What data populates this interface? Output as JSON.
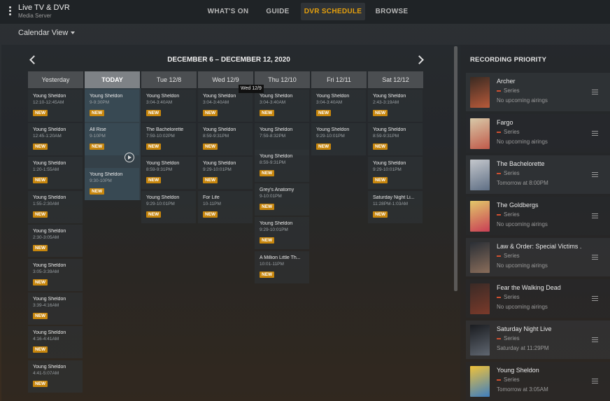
{
  "app": {
    "title": "Live TV & DVR",
    "subtitle": "Media Server"
  },
  "nav": {
    "tabs": [
      "WHAT'S ON",
      "GUIDE",
      "DVR SCHEDULE",
      "BROWSE"
    ],
    "active": "DVR SCHEDULE"
  },
  "view_selector": "Calendar View",
  "calendar": {
    "date_range": "DECEMBER 6 – DECEMBER 12, 2020",
    "days": [
      "Yesterday",
      "TODAY",
      "Tue 12/8",
      "Wed 12/9",
      "Thu 12/10",
      "Fri 12/11",
      "Sat 12/12"
    ],
    "tooltip": "Wed 12/9",
    "badge_label": "NEW",
    "events": [
      [
        {
          "title": "Young Sheldon",
          "time": "12:10-12:45AM",
          "badge": "NEW"
        },
        {
          "title": "Young Sheldon",
          "time": "12:45-1:20AM",
          "badge": "NEW"
        },
        {
          "title": "Young Sheldon",
          "time": "1:20-1:55AM",
          "badge": "NEW"
        },
        {
          "title": "Young Sheldon",
          "time": "1:55-2:30AM",
          "badge": "NEW"
        },
        {
          "title": "Young Sheldon",
          "time": "2:30-3:05AM",
          "badge": "NEW"
        },
        {
          "title": "Young Sheldon",
          "time": "3:05-3:39AM",
          "badge": "NEW"
        },
        {
          "title": "Young Sheldon",
          "time": "3:39-4:16AM",
          "badge": "NEW"
        },
        {
          "title": "Young Sheldon",
          "time": "4:16-4:41AM",
          "badge": "NEW"
        },
        {
          "title": "Young Sheldon",
          "time": "4:41-5:07AM",
          "badge": "NEW"
        }
      ],
      [
        {
          "title": "Young Sheldon",
          "time": "9-9:30PM",
          "badge": "NEW"
        },
        {
          "title": "All Rise",
          "time": "9-10PM",
          "badge": "NEW"
        },
        {
          "title": "Young Sheldon",
          "time": "9:30-10PM",
          "badge": "NEW"
        }
      ],
      [
        {
          "title": "Young Sheldon",
          "time": "3:04-3:40AM",
          "badge": "NEW"
        },
        {
          "title": "The Bachelorette",
          "time": "7:59-10:02PM",
          "badge": "NEW"
        },
        {
          "title": "Young Sheldon",
          "time": "8:59-9:31PM",
          "badge": "NEW"
        },
        {
          "title": "Young Sheldon",
          "time": "9:29-10:01PM",
          "badge": "NEW"
        }
      ],
      [
        {
          "title": "Young Sheldon",
          "time": "3:04-3:40AM",
          "badge": "NEW"
        },
        {
          "title": "Young Sheldon",
          "time": "8:59-9:31PM",
          "badge": "NEW"
        },
        {
          "title": "Young Sheldon",
          "time": "9:29-10:01PM",
          "badge": "NEW"
        },
        {
          "title": "For Life",
          "time": "10-11PM",
          "badge": "NEW"
        }
      ],
      [
        {
          "title": "Young Sheldon",
          "time": "3:04-3:40AM",
          "badge": "NEW"
        },
        {
          "title": "Young Sheldon",
          "time": "7:59-8:32PM",
          "badge": ""
        },
        {
          "title": "Young Sheldon",
          "time": "8:59-9:31PM",
          "badge": "NEW"
        },
        {
          "title": "Grey's Anatomy",
          "time": "9-10:01PM",
          "badge": "NEW"
        },
        {
          "title": "Young Sheldon",
          "time": "9:29-10:01PM",
          "badge": "NEW"
        },
        {
          "title": "A Million Little Th...",
          "time": "10:01-11PM",
          "badge": "NEW"
        }
      ],
      [
        {
          "title": "Young Sheldon",
          "time": "3:04-3:40AM",
          "badge": "NEW"
        },
        {
          "title": "Young Sheldon",
          "time": "9:29-10:01PM",
          "badge": "NEW"
        }
      ],
      [
        {
          "title": "Young Sheldon",
          "time": "2:43-3:19AM",
          "badge": "NEW"
        },
        {
          "title": "Young Sheldon",
          "time": "8:59-9:31PM",
          "badge": "NEW"
        },
        {
          "title": "Young Sheldon",
          "time": "9:29-10:01PM",
          "badge": "NEW"
        },
        {
          "title": "Saturday Night Li...",
          "time": "11:28PM-1:03AM",
          "badge": "NEW"
        }
      ]
    ]
  },
  "priority": {
    "title": "RECORDING PRIORITY",
    "items": [
      {
        "name": "Archer",
        "type": "Series",
        "status": "No upcoming airings",
        "colors": [
          "#3a2a22",
          "#b85a3a"
        ]
      },
      {
        "name": "Fargo",
        "type": "Series",
        "status": "No upcoming airings",
        "colors": [
          "#d8c9a8",
          "#c05a4a"
        ]
      },
      {
        "name": "The Bachelorette",
        "type": "Series",
        "status": "Tomorrow at 8:00PM",
        "colors": [
          "#c4c7cc",
          "#5f6f85"
        ]
      },
      {
        "name": "The Goldbergs",
        "type": "Series",
        "status": "No upcoming airings",
        "colors": [
          "#e2c86a",
          "#c93f55"
        ]
      },
      {
        "name": "Law & Order: Special Victims ...",
        "type": "Series",
        "status": "No upcoming airings",
        "colors": [
          "#2a2f36",
          "#8a6d5a"
        ]
      },
      {
        "name": "Fear the Walking Dead",
        "type": "Series",
        "status": "No upcoming airings",
        "colors": [
          "#3a2a26",
          "#7a3a2a"
        ]
      },
      {
        "name": "Saturday Night Live",
        "type": "Series",
        "status": "Saturday at 11:29PM",
        "colors": [
          "#1a1c20",
          "#5f6670"
        ]
      },
      {
        "name": "Young Sheldon",
        "type": "Series",
        "status": "Tomorrow at 3:05AM",
        "colors": [
          "#f0c23a",
          "#3f7fc0"
        ]
      }
    ]
  }
}
